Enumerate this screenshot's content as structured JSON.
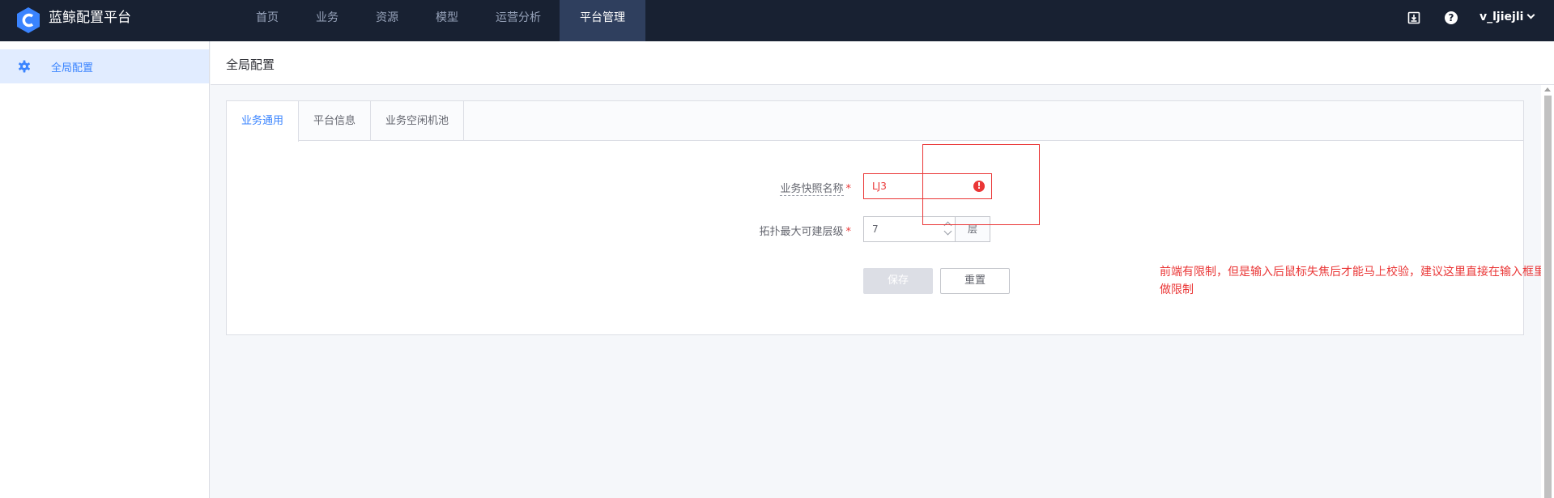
{
  "app": {
    "title": "蓝鲸配置平台"
  },
  "nav": {
    "items": [
      {
        "label": "首页"
      },
      {
        "label": "业务"
      },
      {
        "label": "资源"
      },
      {
        "label": "模型"
      },
      {
        "label": "运营分析"
      },
      {
        "label": "平台管理",
        "active": true
      }
    ]
  },
  "topbar": {
    "icons": [
      "export-icon",
      "help-icon"
    ],
    "user": "v_ljiejli"
  },
  "sidebar": {
    "items": [
      {
        "label": "全局配置",
        "icon": "gear-icon",
        "active": true
      }
    ]
  },
  "main": {
    "title": "全局配置"
  },
  "tabs": [
    {
      "label": "业务通用",
      "active": true
    },
    {
      "label": "平台信息"
    },
    {
      "label": "业务空闲机池"
    }
  ],
  "form": {
    "snapshot_name": {
      "label": "业务快照名称",
      "required_mark": "*",
      "value": "LJ3",
      "error": true
    },
    "topo_max_level": {
      "label": "拓扑最大可建层级",
      "required_mark": "*",
      "value": "7",
      "suffix": "层"
    },
    "save_label": "保存",
    "reset_label": "重置"
  },
  "annotation": {
    "text": "前端有限制，但是输入后鼠标失焦后才能马上校验，建议这里直接在输入框里做限制",
    "color": "#ea3636"
  },
  "colors": {
    "topbar": "#182132",
    "accent": "#3a84ff",
    "error": "#ea3636"
  }
}
